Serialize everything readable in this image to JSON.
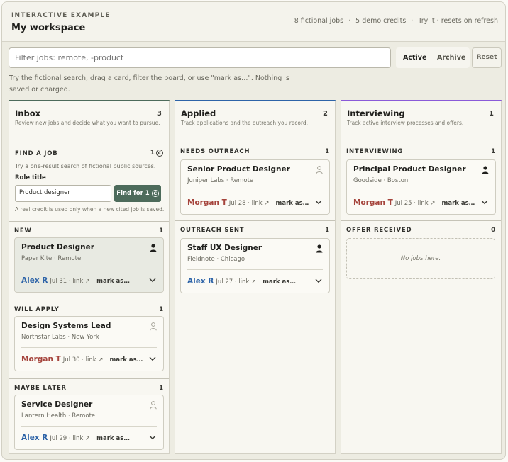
{
  "header": {
    "eyebrow": "INTERACTIVE EXAMPLE",
    "title": "My workspace",
    "meta": [
      "8 fictional jobs",
      "5 demo credits",
      "Try it · resets on refresh"
    ]
  },
  "toolbar": {
    "filter_placeholder": "Filter jobs: remote, -product",
    "tab_active": "Active",
    "tab_archive": "Archive",
    "reset": "Reset"
  },
  "hint": "Try the fictional search, drag a card, filter the board, or use \"mark as…\". Nothing is saved or charged.",
  "colors": {
    "inbox": "#4d6b5b",
    "applied": "#2e64a8",
    "interviewing": "#8a5ad8",
    "blue_person": "#2e64a8",
    "red_person": "#a5443c"
  },
  "columns": {
    "inbox": {
      "title": "Inbox",
      "count": "3",
      "desc": "Review new jobs and decide what you want to pursue.",
      "find": {
        "title": "FIND A JOB",
        "credit": "1",
        "desc": "Try a one-result search of fictional public sources.",
        "role_label": "Role title",
        "role_value": "Product designer",
        "button": "Find for 1",
        "note": "A real credit is used only when a new cited job is saved."
      },
      "sections": [
        {
          "label": "NEW",
          "count": "1",
          "card": {
            "title": "Product Designer",
            "sub": "Paper Kite · Remote",
            "who": "Alex R",
            "date": "Jul 31 · link ↗",
            "mark": "mark as…",
            "icon": "person-filled-icon"
          }
        },
        {
          "label": "WILL APPLY",
          "count": "1",
          "card": {
            "title": "Design Systems Lead",
            "sub": "Northstar Labs · New York",
            "who": "Morgan T",
            "date": "Jul 30 · link ↗",
            "mark": "mark as…",
            "icon": "person-outline-icon"
          }
        },
        {
          "label": "MAYBE LATER",
          "count": "1",
          "card": {
            "title": "Service Designer",
            "sub": "Lantern Health · Remote",
            "who": "Alex R",
            "date": "Jul 29 · link ↗",
            "mark": "mark as…",
            "icon": "person-outline-icon"
          }
        }
      ]
    },
    "applied": {
      "title": "Applied",
      "count": "2",
      "desc": "Track applications and the outreach you record.",
      "sections": [
        {
          "label": "NEEDS OUTREACH",
          "count": "1",
          "card": {
            "title": "Senior Product Designer",
            "sub": "Juniper Labs · Remote",
            "who": "Morgan T",
            "date": "Jul 28 · link ↗",
            "mark": "mark as…",
            "icon": "person-outline-icon"
          }
        },
        {
          "label": "OUTREACH SENT",
          "count": "1",
          "card": {
            "title": "Staff UX Designer",
            "sub": "Fieldnote · Chicago",
            "who": "Alex R",
            "date": "Jul 27 · link ↗",
            "mark": "mark as…",
            "icon": "person-filled-icon"
          }
        }
      ]
    },
    "interviewing": {
      "title": "Interviewing",
      "count": "1",
      "desc": "Track active interview processes and offers.",
      "sections": [
        {
          "label": "INTERVIEWING",
          "count": "1",
          "card": {
            "title": "Principal Product Designer",
            "sub": "Goodside · Boston",
            "who": "Morgan T",
            "date": "Jul 25 · link ↗",
            "mark": "mark as…",
            "icon": "person-filled-icon"
          }
        },
        {
          "label": "OFFER RECEIVED",
          "count": "0",
          "empty": "No jobs here."
        }
      ]
    }
  }
}
